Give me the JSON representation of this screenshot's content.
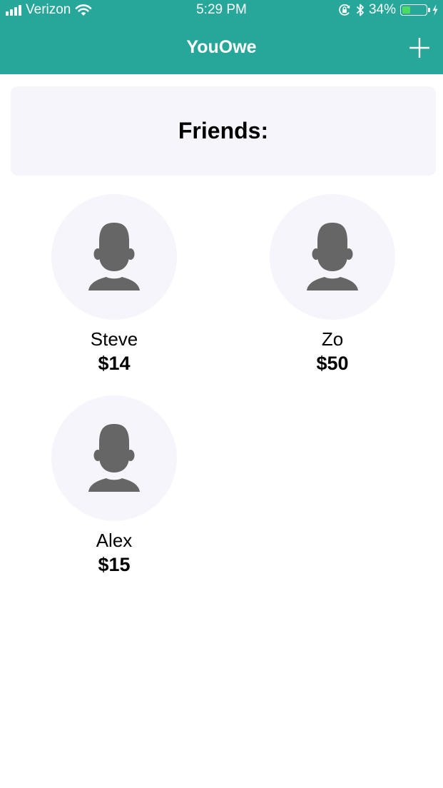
{
  "status_bar": {
    "carrier": "Verizon",
    "time": "5:29 PM",
    "battery_percent": "34%",
    "battery_level": 0.34,
    "icons": [
      "signal-icon",
      "wifi-icon",
      "rotation-lock-icon",
      "bluetooth-icon",
      "battery-icon",
      "charging-icon"
    ]
  },
  "nav": {
    "title": "YouOwe",
    "add_icon": "plus-icon"
  },
  "header": {
    "title": "Friends:"
  },
  "friends": [
    {
      "name": "Steve",
      "amount": "$14"
    },
    {
      "name": "Zo",
      "amount": "$50"
    },
    {
      "name": "Alex",
      "amount": "$15"
    }
  ],
  "colors": {
    "accent": "#27a79a",
    "card_background": "#f6f5fb",
    "avatar_silhouette": "#666666",
    "battery_fill": "#4cd964"
  }
}
